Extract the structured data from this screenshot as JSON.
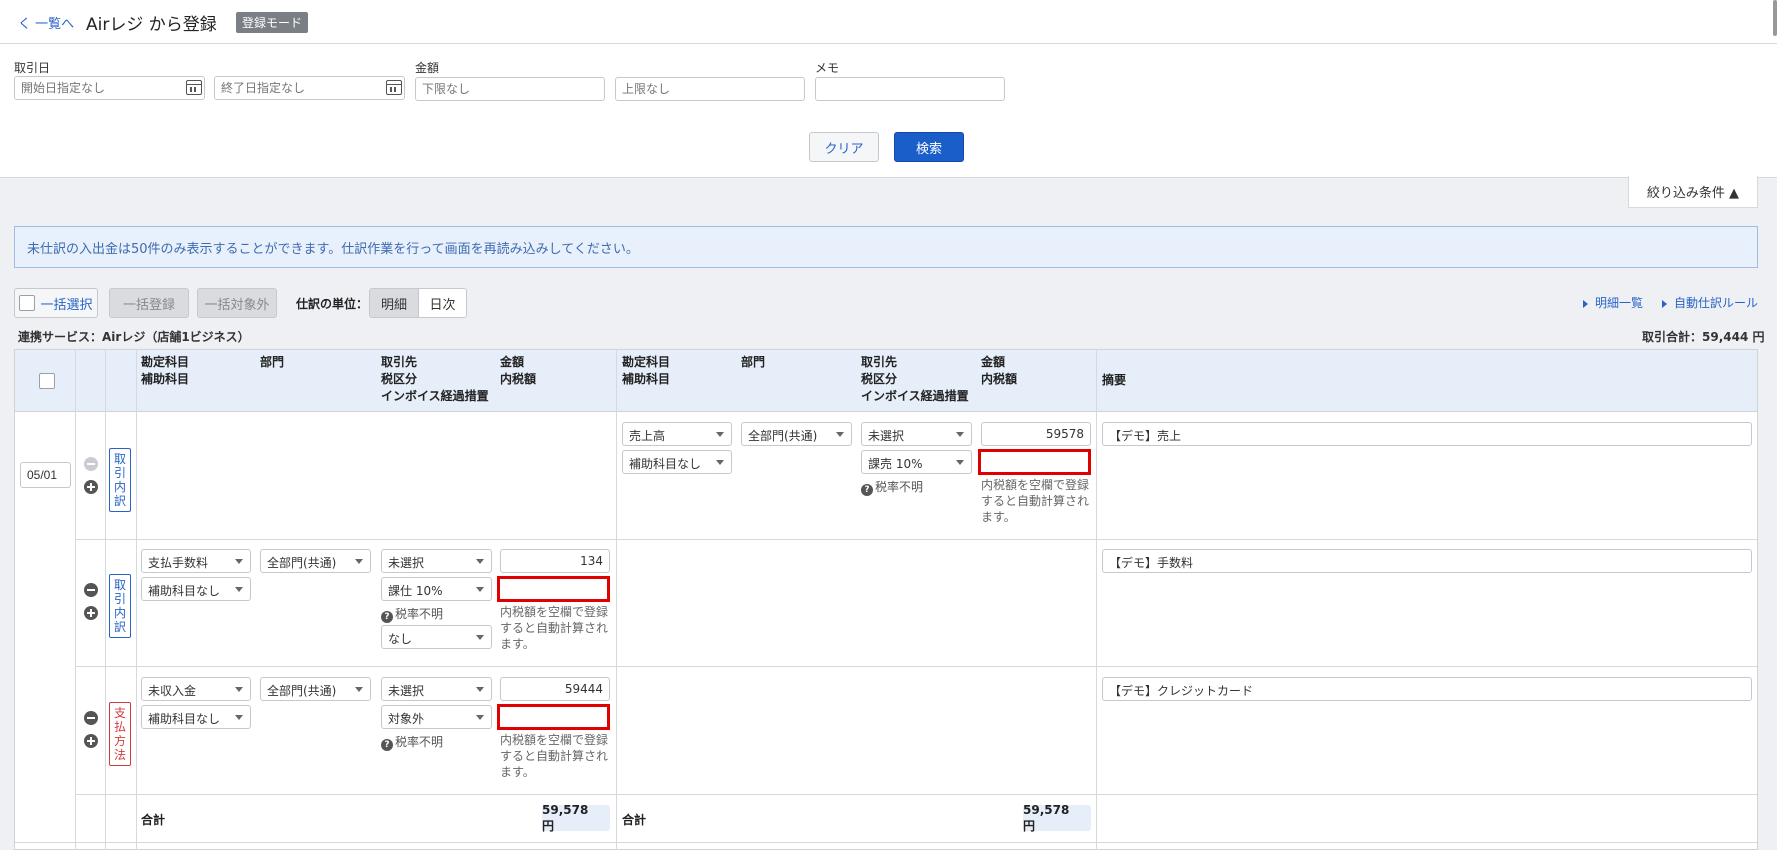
{
  "header": {
    "back": "く 一覧へ",
    "title": "Airレジ から登録",
    "badge": "登録モード"
  },
  "filters": {
    "date_label": "取引日",
    "start_placeholder": "開始日指定なし",
    "end_placeholder": "終了日指定なし",
    "amount_label": "金額",
    "min_placeholder": "下限なし",
    "max_placeholder": "上限なし",
    "memo_label": "メモ",
    "clear": "クリア",
    "search": "検索",
    "narrow": "絞り込み条件 ▲"
  },
  "notice": "未仕訳の入出金は50件のみ表示することができます。仕訳作業を行って画面を再読み込みしてください。",
  "toolbar": {
    "select_all": "一括選択",
    "bulk_register": "一括登録",
    "bulk_exclude": "一括対象外",
    "unit_label": "仕訳の単位：",
    "unit_detail": "明細",
    "unit_daily": "日次",
    "detail_list": "明細一覧",
    "auto_rule": "自動仕訳ルール"
  },
  "service": "連携サービス：Airレジ（店舗1ビジネス）",
  "trade_total": "取引合計：59,444 円",
  "columns": {
    "account": "勘定科目",
    "sub_account": "補助科目",
    "dept": "部門",
    "partner": "取引先",
    "tax_class": "税区分",
    "invoice": "インボイス経過措置",
    "amount": "金額",
    "tax_incl": "内税額",
    "memo": "摘要"
  },
  "rows": {
    "date": "05/01",
    "row1": {
      "tag": "取引内訳",
      "account": "売上高",
      "sub": "補助科目なし",
      "dept": "全部門(共通)",
      "partner": "未選択",
      "tax": "課売 10%",
      "tax_note": "税率不明",
      "amount": "59578",
      "hint": "内税額を空欄で登録すると自動計算されます。",
      "memo": "【デモ】売上"
    },
    "row2": {
      "tag": "取引内訳",
      "account": "支払手数料",
      "sub": "補助科目なし",
      "dept": "全部門(共通)",
      "partner": "未選択",
      "tax": "課仕 10%",
      "tax_note": "税率不明",
      "invoice": "なし",
      "amount": "134",
      "hint": "内税額を空欄で登録すると自動計算されます。",
      "memo": "【デモ】手数料"
    },
    "row3": {
      "tag": "支払方法",
      "account": "未収入金",
      "sub": "補助科目なし",
      "dept": "全部門(共通)",
      "partner": "未選択",
      "tax": "対象外",
      "tax_note": "税率不明",
      "amount": "59444",
      "hint": "内税額を空欄で登録すると自動計算されます。",
      "memo": "【デモ】クレジットカード"
    }
  },
  "totals": {
    "label": "合計",
    "debit": "59,578円",
    "credit": "59,578円"
  }
}
